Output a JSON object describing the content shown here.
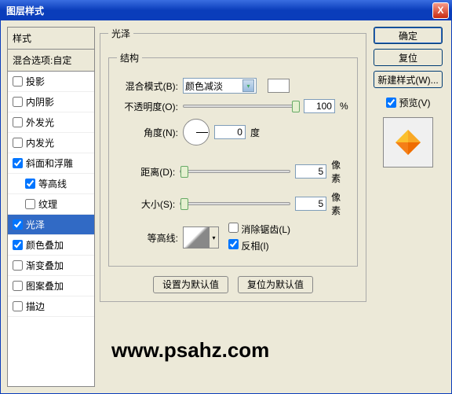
{
  "title": "图层样式",
  "close": "X",
  "left": {
    "header": "样式",
    "blend": "混合选项:自定",
    "items": [
      {
        "label": "投影",
        "checked": false,
        "indent": false
      },
      {
        "label": "内阴影",
        "checked": false,
        "indent": false
      },
      {
        "label": "外发光",
        "checked": false,
        "indent": false
      },
      {
        "label": "内发光",
        "checked": false,
        "indent": false
      },
      {
        "label": "斜面和浮雕",
        "checked": true,
        "indent": false
      },
      {
        "label": "等高线",
        "checked": true,
        "indent": true
      },
      {
        "label": "纹理",
        "checked": false,
        "indent": true
      },
      {
        "label": "光泽",
        "checked": true,
        "indent": false,
        "selected": true
      },
      {
        "label": "颜色叠加",
        "checked": true,
        "indent": false
      },
      {
        "label": "渐变叠加",
        "checked": false,
        "indent": false
      },
      {
        "label": "图案叠加",
        "checked": false,
        "indent": false
      },
      {
        "label": "描边",
        "checked": false,
        "indent": false
      }
    ]
  },
  "center": {
    "group_title": "光泽",
    "struct_title": "结构",
    "blend_mode_label": "混合模式(B):",
    "blend_mode_value": "颜色减淡",
    "opacity_label": "不透明度(O):",
    "opacity_value": "100",
    "opacity_unit": "%",
    "angle_label": "角度(N):",
    "angle_value": "0",
    "angle_unit": "度",
    "distance_label": "距离(D):",
    "distance_value": "5",
    "distance_unit": "像素",
    "size_label": "大小(S):",
    "size_value": "5",
    "size_unit": "像素",
    "contour_label": "等高线:",
    "antialias_label": "消除锯齿(L)",
    "invert_label": "反相(I)",
    "set_default": "设置为默认值",
    "reset_default": "复位为默认值"
  },
  "right": {
    "ok": "确定",
    "cancel": "复位",
    "new_style": "新建样式(W)...",
    "preview": "预览(V)"
  },
  "watermark": "www.psahz.com"
}
